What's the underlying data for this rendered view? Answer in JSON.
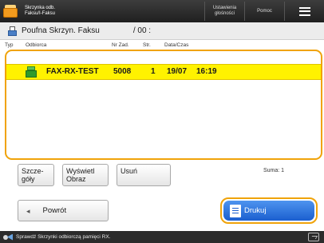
{
  "header": {
    "app_title_line1": "Skrzynka odb.",
    "app_title_line2": "Faksu/I-Faksu",
    "settings_line1": "Ustawienia",
    "settings_line2": "głośności",
    "help_label": "Pomoc"
  },
  "box": {
    "name": "Poufna Skrzyn. Faksu",
    "number": "/ 00 :"
  },
  "columns": {
    "type": "Typ",
    "recipient": "Odbiorca",
    "job_no": "Nr Zad.",
    "pages": "Str.",
    "datetime": "Data/Czas"
  },
  "rows": [
    {
      "recipient": "FAX-RX-TEST",
      "job_no": "5008",
      "pages": "1",
      "date": "19/07",
      "time": "16:19"
    }
  ],
  "actions": {
    "details_line1": "Szcze-",
    "details_line2": "góły",
    "view_line1": "Wyświetl",
    "view_line2": "Obraz",
    "delete": "Usuń",
    "total": "Suma: 1",
    "back": "Powrót",
    "print": "Drukuj"
  },
  "status": {
    "message": "Sprawdź Skrzynki odbiorczą pamięci RX."
  },
  "colors": {
    "accent_orange": "#f0a30a",
    "selected_row": "#fff200",
    "primary_button": "#1b5fcf"
  }
}
